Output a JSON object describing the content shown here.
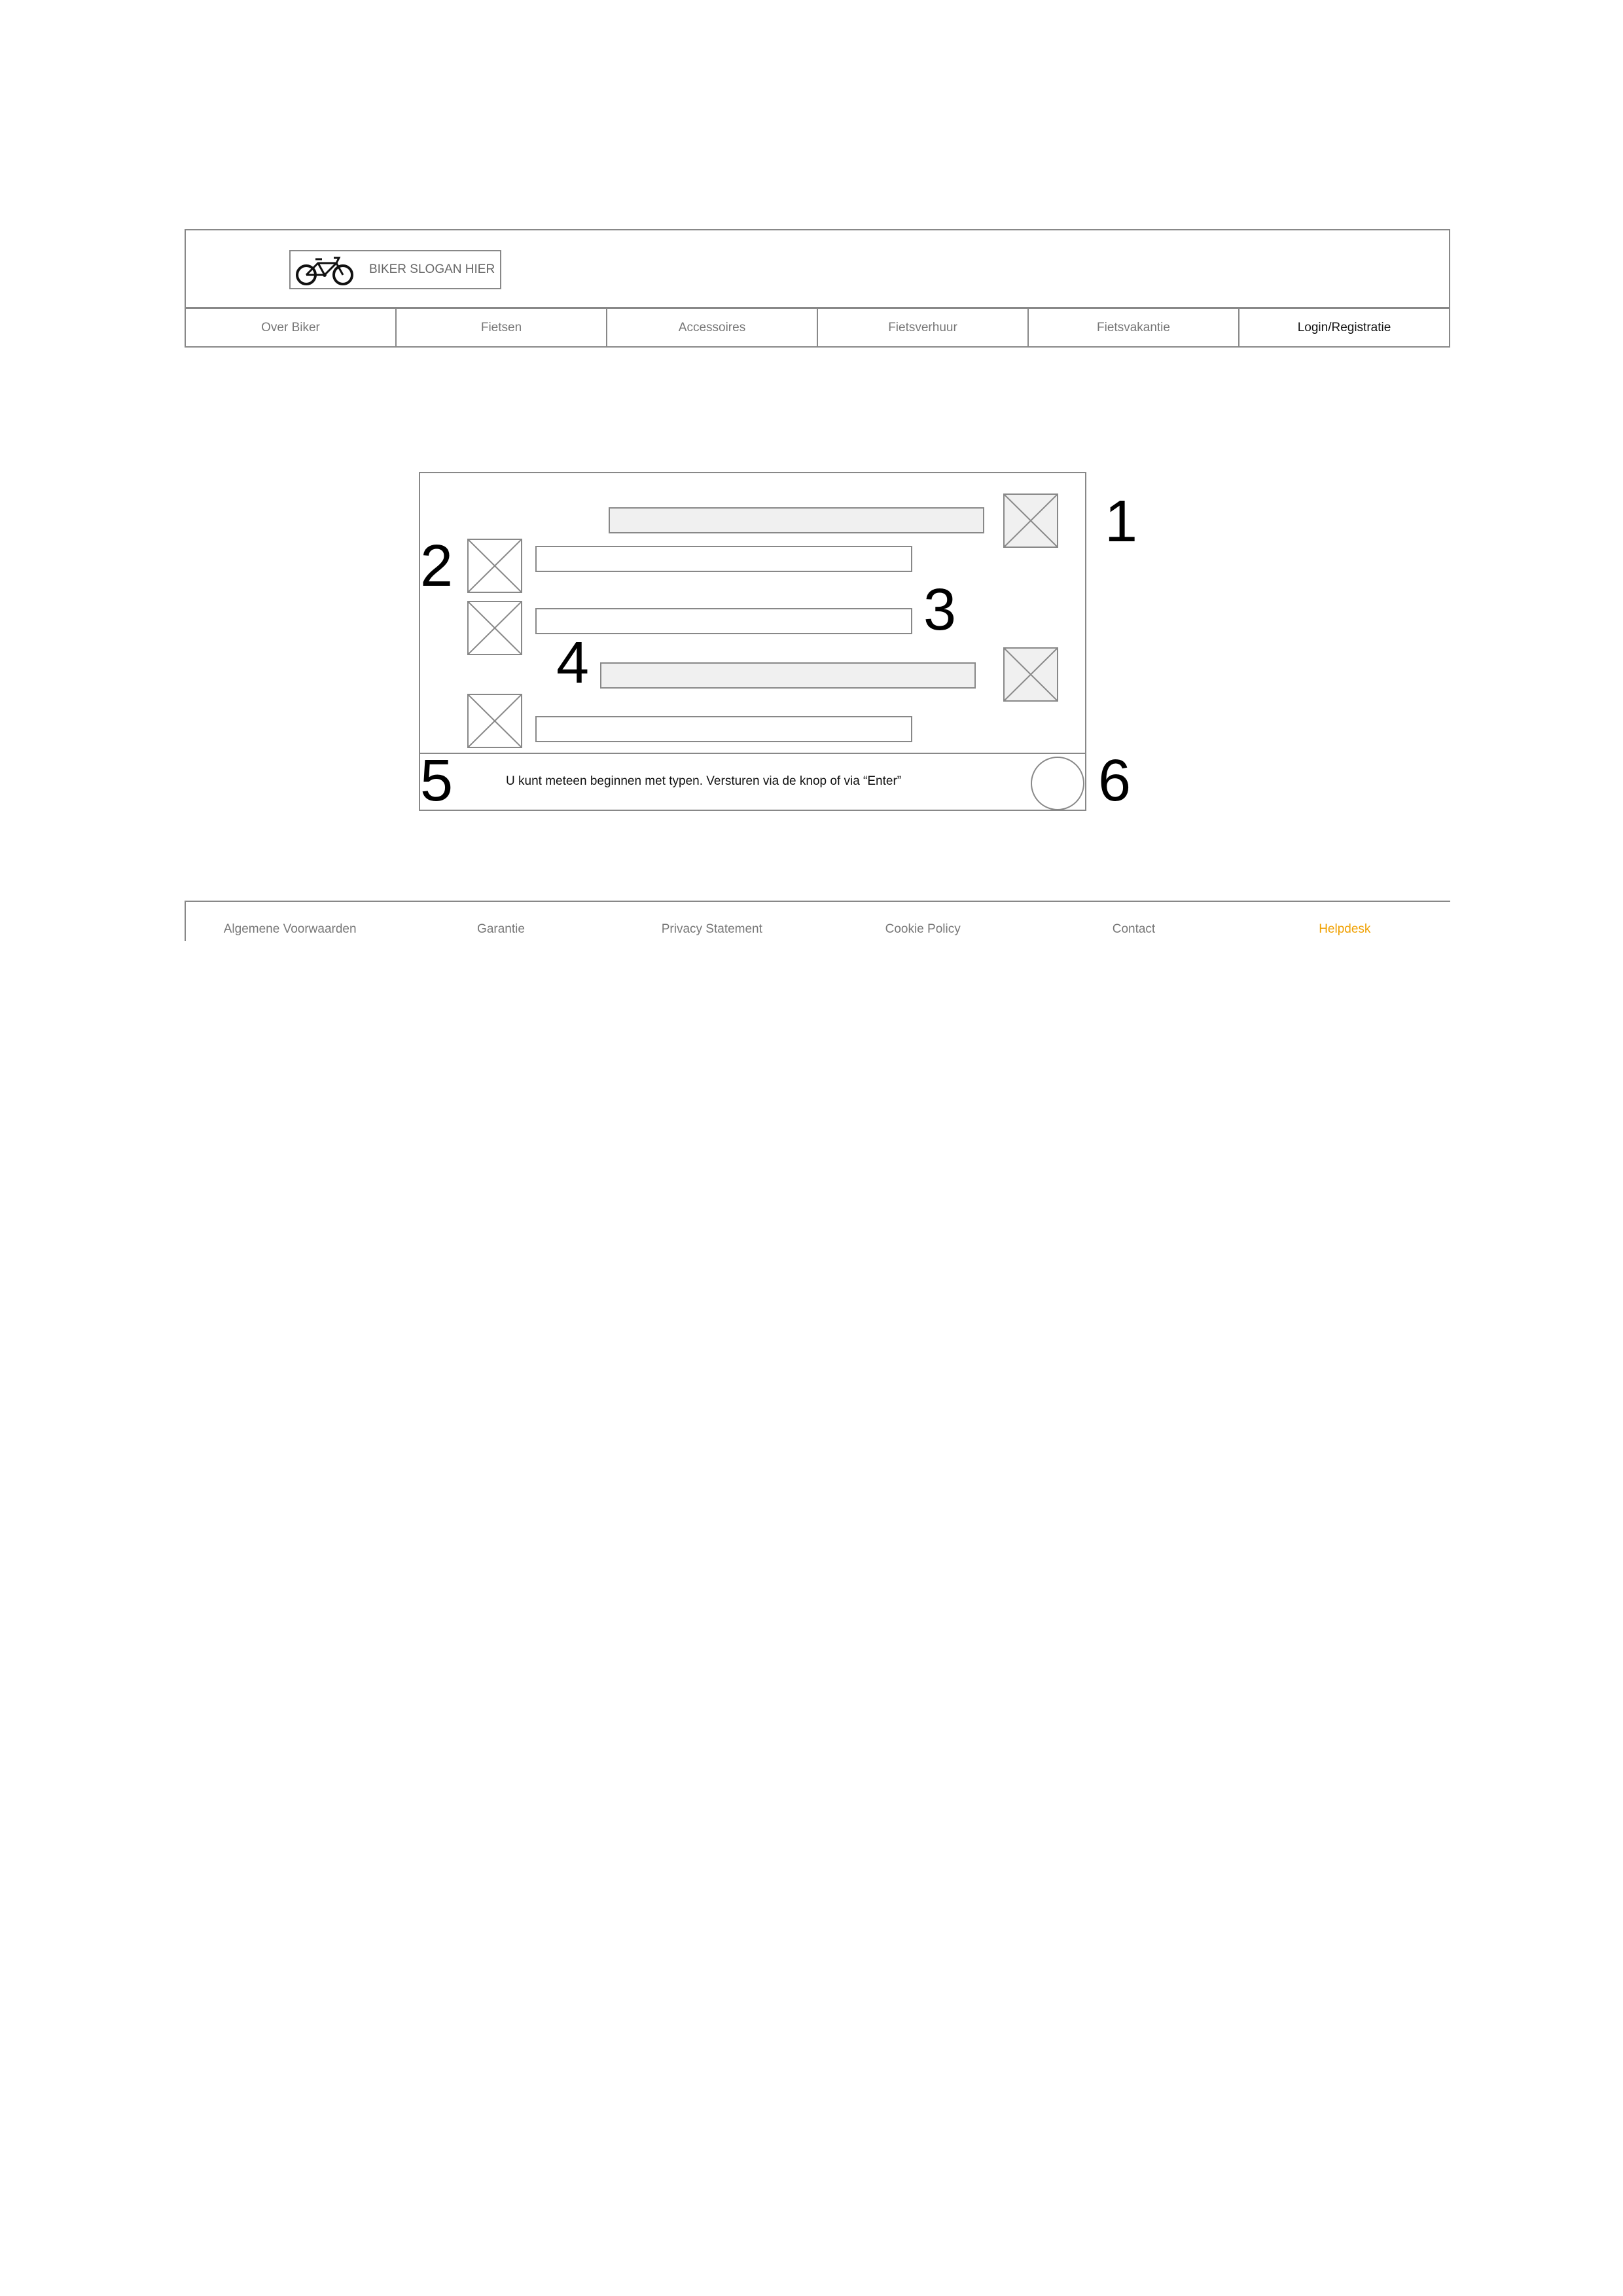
{
  "header": {
    "logo_icon": "bicycle-icon",
    "slogan": "BIKER SLOGAN HIER"
  },
  "nav": {
    "items": [
      {
        "label": "Over Biker"
      },
      {
        "label": "Fietsen"
      },
      {
        "label": "Accessoires"
      },
      {
        "label": "Fietsverhuur"
      },
      {
        "label": "Fietsvakantie"
      },
      {
        "label": "Login/Registratie"
      }
    ]
  },
  "chat": {
    "annotations": [
      "1",
      "2",
      "3",
      "4",
      "5",
      "6"
    ],
    "input_hint": "U kunt meteen beginnen met typen. Versturen via de knop of via “Enter”",
    "send_icon": "circle-icon",
    "avatar_icon": "image-placeholder-icon"
  },
  "footer": {
    "links": [
      {
        "label": "Algemene Voorwaarden"
      },
      {
        "label": "Garantie"
      },
      {
        "label": "Privacy Statement"
      },
      {
        "label": "Cookie Policy"
      },
      {
        "label": "Contact"
      },
      {
        "label": "Helpdesk"
      }
    ],
    "accent_color": "#f0a000"
  }
}
